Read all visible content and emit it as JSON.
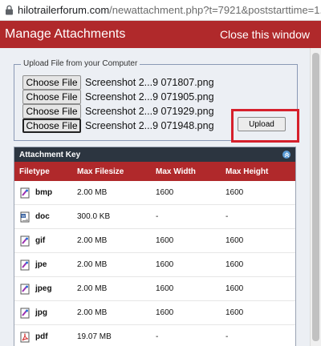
{
  "browser": {
    "url_host": "hilotrailerforum.com",
    "url_path": "/newattachment.php?t=7921&poststarttime=1..."
  },
  "window": {
    "title": "Manage Attachments",
    "close_label": "Close this window"
  },
  "upload": {
    "legend": "Upload File from your Computer",
    "choose_label": "Choose File",
    "files": [
      "Screenshot 2...9 071807.png",
      "Screenshot 2...9 071905.png",
      "Screenshot 2...9 071929.png",
      "Screenshot 2...9 071948.png"
    ],
    "upload_label": "Upload"
  },
  "attachment_key": {
    "title": "Attachment Key",
    "columns": [
      "Filetype",
      "Max Filesize",
      "Max Width",
      "Max Height"
    ],
    "rows": [
      {
        "ext": "bmp",
        "size": "2.00 MB",
        "width": "1600",
        "height": "1600",
        "icon": "bmp-file-icon"
      },
      {
        "ext": "doc",
        "size": "300.0 KB",
        "width": "-",
        "height": "-",
        "icon": "doc-file-icon"
      },
      {
        "ext": "gif",
        "size": "2.00 MB",
        "width": "1600",
        "height": "1600",
        "icon": "gif-file-icon"
      },
      {
        "ext": "jpe",
        "size": "2.00 MB",
        "width": "1600",
        "height": "1600",
        "icon": "jpe-file-icon"
      },
      {
        "ext": "jpeg",
        "size": "2.00 MB",
        "width": "1600",
        "height": "1600",
        "icon": "jpeg-file-icon"
      },
      {
        "ext": "jpg",
        "size": "2.00 MB",
        "width": "1600",
        "height": "1600",
        "icon": "jpg-file-icon"
      },
      {
        "ext": "pdf",
        "size": "19.07 MB",
        "width": "-",
        "height": "-",
        "icon": "pdf-file-icon"
      }
    ]
  },
  "colors": {
    "header_bg": "#b0292b",
    "key_header_bg": "#2c3540",
    "highlight": "#d6202c"
  }
}
